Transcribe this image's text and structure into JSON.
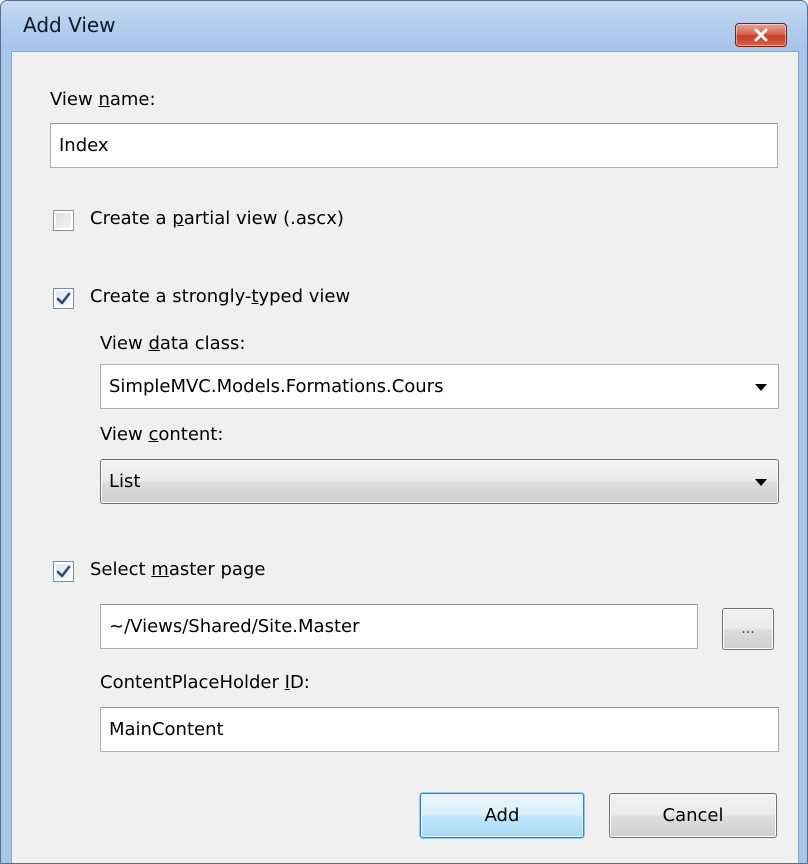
{
  "window": {
    "title": "Add View",
    "close_icon": "close-icon"
  },
  "form": {
    "view_name": {
      "label_pre": "View ",
      "label_access": "n",
      "label_post": "ame:",
      "value": "Index"
    },
    "partial_view": {
      "label_pre": "Create a ",
      "label_access": "p",
      "label_post": "artial view (.ascx)",
      "checked": false
    },
    "strongly_typed": {
      "label_pre": "Create a strongly-",
      "label_access": "t",
      "label_post": "yped view",
      "checked": true
    },
    "view_data_class": {
      "label_pre": "View ",
      "label_access": "d",
      "label_post": "ata class:",
      "value": "SimpleMVC.Models.Formations.Cours"
    },
    "view_content": {
      "label_pre": "View ",
      "label_access": "c",
      "label_post": "ontent:",
      "value": "List"
    },
    "master_page": {
      "label_pre": "Select ",
      "label_access": "m",
      "label_post": "aster page",
      "checked": true,
      "path": "~/Views/Shared/Site.Master",
      "browse_label": "..."
    },
    "content_placeholder": {
      "label_pre": "ContentPlaceHolder ",
      "label_access": "I",
      "label_post": "D:",
      "value": "MainContent"
    }
  },
  "buttons": {
    "add": "Add",
    "cancel": "Cancel"
  },
  "colors": {
    "frame": "#a9c4e8",
    "client": "#f0f0f0",
    "close": "#c53f22",
    "default_button": "#bee6fd"
  }
}
